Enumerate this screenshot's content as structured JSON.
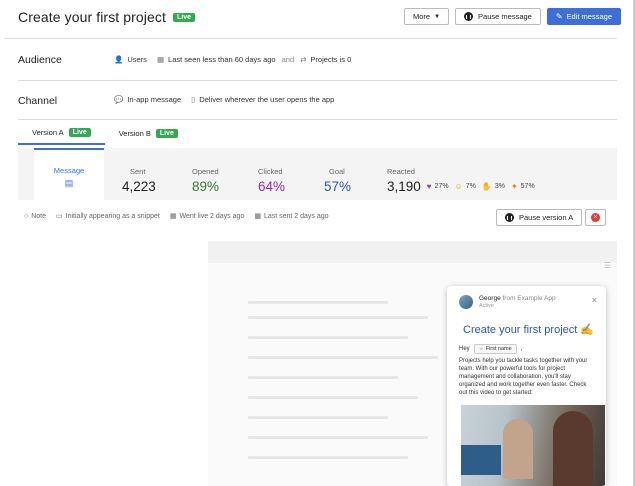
{
  "header": {
    "title": "Create your first project",
    "status_badge": "Live",
    "more_label": "More",
    "pause_label": "Pause message",
    "edit_label": "Edit message"
  },
  "audience": {
    "label": "Audience",
    "users": "Users",
    "rule1": "Last seen less than 60 days ago",
    "joiner": "and",
    "rule2": "Projects is 0"
  },
  "channel": {
    "label": "Channel",
    "type": "In-app message",
    "delivery": "Deliver wherever the user opens the app"
  },
  "versions": [
    {
      "label": "Version A",
      "badge": "Live"
    },
    {
      "label": "Version B",
      "badge": "Live"
    }
  ],
  "stats": {
    "message_label": "Message",
    "sent": {
      "label": "Sent",
      "value": "4,223"
    },
    "opened": {
      "label": "Opened",
      "value": "89%",
      "color": "#2e7d32"
    },
    "clicked": {
      "label": "Clicked",
      "value": "64%",
      "color": "#9c27b0"
    },
    "goal": {
      "label": "Goal",
      "value": "57%",
      "color": "#2c55b8"
    },
    "reacted": {
      "label": "Reacted",
      "value": "3,190"
    },
    "reactions": [
      "27%",
      "7%",
      "3%",
      "57%"
    ]
  },
  "meta": {
    "note": "Note",
    "snippet": "Initially appearing as a snippet",
    "went_live": "Went live 2 days ago",
    "last_sent": "Last sent 2 days ago",
    "pause_version": "Pause version A"
  },
  "card": {
    "sender": "George",
    "from": "from Example App",
    "status": "Active",
    "title": "Create your first project ✍️",
    "hey": "Hey",
    "attr": "First name",
    "body": "Projects help you tackle tasks together with your team. With our powerful tools for project management and collaboration, you'll stay organized and work together even faster. Check out this video to get started:"
  }
}
